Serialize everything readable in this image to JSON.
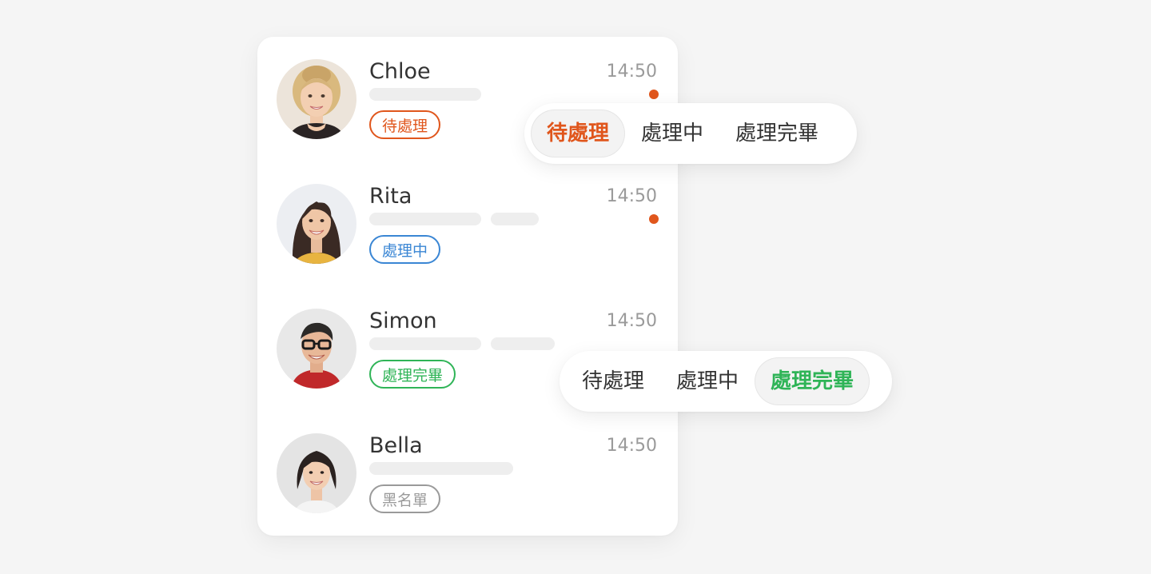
{
  "colors": {
    "background": "#f5f5f5",
    "card": "#ffffff",
    "pending": "#e0561c",
    "in_progress": "#3a86d4",
    "done": "#2fb457",
    "blacklist": "#9a9a9a",
    "unread_dot": "#e0561c",
    "skeleton": "#eeeeee"
  },
  "conversations": [
    {
      "name": "Chloe",
      "time": "14:50",
      "status": "待處理",
      "status_key": "pending",
      "unread": true,
      "avatar_icon": "woman-blonde-avatar-icon"
    },
    {
      "name": "Rita",
      "time": "14:50",
      "status": "處理中",
      "status_key": "in_progress",
      "unread": true,
      "avatar_icon": "woman-brunette-avatar-icon"
    },
    {
      "name": "Simon",
      "time": "14:50",
      "status": "處理完畢",
      "status_key": "done",
      "unread": false,
      "avatar_icon": "man-glasses-avatar-icon"
    },
    {
      "name": "Bella",
      "time": "14:50",
      "status": "黑名單",
      "status_key": "blacklist",
      "unread": false,
      "avatar_icon": "woman-bob-avatar-icon"
    }
  ],
  "status_selectors": [
    {
      "options": [
        "待處理",
        "處理中",
        "處理完畢"
      ],
      "selected": "待處理"
    },
    {
      "options": [
        "待處理",
        "處理中",
        "處理完畢"
      ],
      "selected": "處理完畢"
    }
  ]
}
